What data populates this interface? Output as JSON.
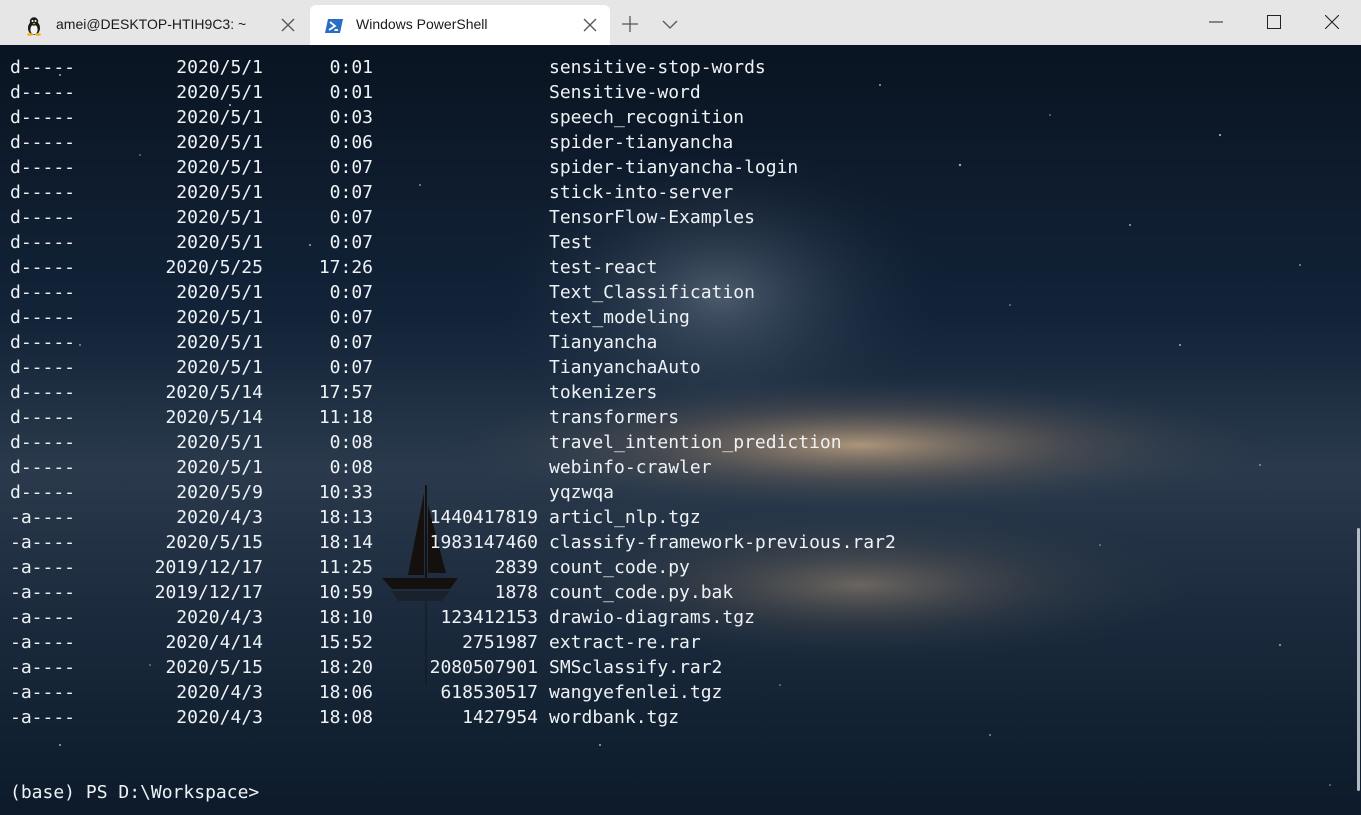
{
  "tabs": [
    {
      "title": "amei@DESKTOP-HTIH9C3: ~",
      "icon": "linux-penguin-icon",
      "active": false
    },
    {
      "title": "Windows PowerShell",
      "icon": "powershell-icon",
      "active": true
    }
  ],
  "listing": [
    {
      "mode": "d-----",
      "date": "2020/5/1",
      "time": "0:01",
      "length": "",
      "name": "sensitive-stop-words"
    },
    {
      "mode": "d-----",
      "date": "2020/5/1",
      "time": "0:01",
      "length": "",
      "name": "Sensitive-word"
    },
    {
      "mode": "d-----",
      "date": "2020/5/1",
      "time": "0:03",
      "length": "",
      "name": "speech_recognition"
    },
    {
      "mode": "d-----",
      "date": "2020/5/1",
      "time": "0:06",
      "length": "",
      "name": "spider-tianyancha"
    },
    {
      "mode": "d-----",
      "date": "2020/5/1",
      "time": "0:07",
      "length": "",
      "name": "spider-tianyancha-login"
    },
    {
      "mode": "d-----",
      "date": "2020/5/1",
      "time": "0:07",
      "length": "",
      "name": "stick-into-server"
    },
    {
      "mode": "d-----",
      "date": "2020/5/1",
      "time": "0:07",
      "length": "",
      "name": "TensorFlow-Examples"
    },
    {
      "mode": "d-----",
      "date": "2020/5/1",
      "time": "0:07",
      "length": "",
      "name": "Test"
    },
    {
      "mode": "d-----",
      "date": "2020/5/25",
      "time": "17:26",
      "length": "",
      "name": "test-react"
    },
    {
      "mode": "d-----",
      "date": "2020/5/1",
      "time": "0:07",
      "length": "",
      "name": "Text_Classification"
    },
    {
      "mode": "d-----",
      "date": "2020/5/1",
      "time": "0:07",
      "length": "",
      "name": "text_modeling"
    },
    {
      "mode": "d-----",
      "date": "2020/5/1",
      "time": "0:07",
      "length": "",
      "name": "Tianyancha"
    },
    {
      "mode": "d-----",
      "date": "2020/5/1",
      "time": "0:07",
      "length": "",
      "name": "TianyanchaAuto"
    },
    {
      "mode": "d-----",
      "date": "2020/5/14",
      "time": "17:57",
      "length": "",
      "name": "tokenizers"
    },
    {
      "mode": "d-----",
      "date": "2020/5/14",
      "time": "11:18",
      "length": "",
      "name": "transformers"
    },
    {
      "mode": "d-----",
      "date": "2020/5/1",
      "time": "0:08",
      "length": "",
      "name": "travel_intention_prediction"
    },
    {
      "mode": "d-----",
      "date": "2020/5/1",
      "time": "0:08",
      "length": "",
      "name": "webinfo-crawler"
    },
    {
      "mode": "d-----",
      "date": "2020/5/9",
      "time": "10:33",
      "length": "",
      "name": "yqzwqa"
    },
    {
      "mode": "-a----",
      "date": "2020/4/3",
      "time": "18:13",
      "length": "1440417819",
      "name": "articl_nlp.tgz"
    },
    {
      "mode": "-a----",
      "date": "2020/5/15",
      "time": "18:14",
      "length": "1983147460",
      "name": "classify-framework-previous.rar2"
    },
    {
      "mode": "-a----",
      "date": "2019/12/17",
      "time": "11:25",
      "length": "2839",
      "name": "count_code.py"
    },
    {
      "mode": "-a----",
      "date": "2019/12/17",
      "time": "10:59",
      "length": "1878",
      "name": "count_code.py.bak"
    },
    {
      "mode": "-a----",
      "date": "2020/4/3",
      "time": "18:10",
      "length": "123412153",
      "name": "drawio-diagrams.tgz"
    },
    {
      "mode": "-a----",
      "date": "2020/4/14",
      "time": "15:52",
      "length": "2751987",
      "name": "extract-re.rar"
    },
    {
      "mode": "-a----",
      "date": "2020/5/15",
      "time": "18:20",
      "length": "2080507901",
      "name": "SMSclassify.rar2"
    },
    {
      "mode": "-a----",
      "date": "2020/4/3",
      "time": "18:06",
      "length": "618530517",
      "name": "wangyefenlei.tgz"
    },
    {
      "mode": "-a----",
      "date": "2020/4/3",
      "time": "18:08",
      "length": "1427954",
      "name": "wordbank.tgz"
    }
  ],
  "prompt": "(base) PS D:\\Workspace>",
  "colors": {
    "titlebar": "#e6e6e6",
    "active_tab": "#ffffff",
    "terminal_text": "#eef2f5",
    "powershell_blue": "#2b6cc4"
  }
}
